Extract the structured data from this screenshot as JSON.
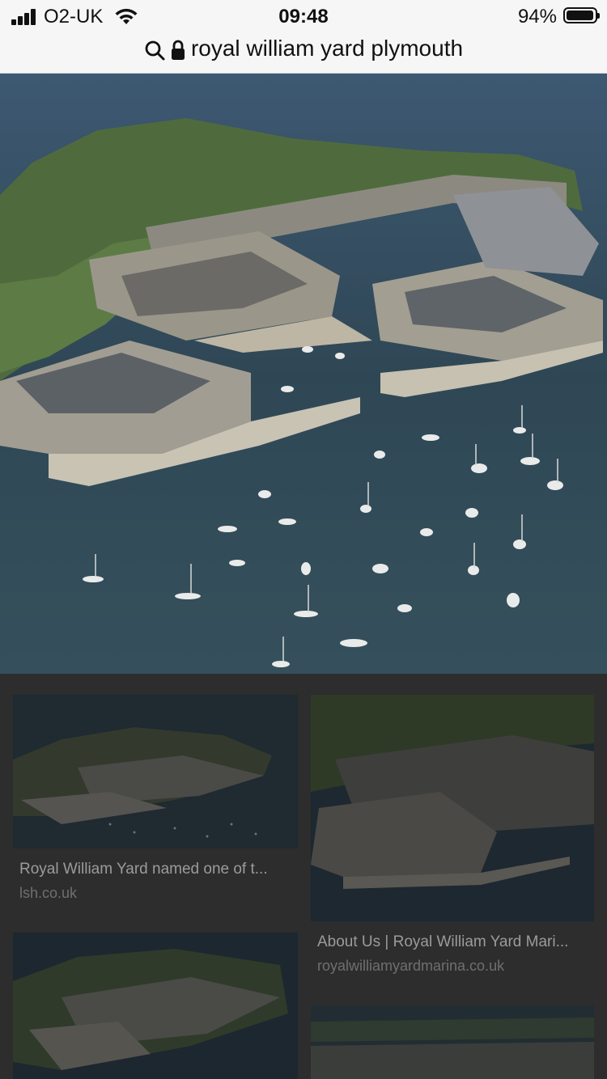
{
  "status_bar": {
    "carrier": "O2-UK",
    "time": "09:48",
    "battery": "94%"
  },
  "address_bar": {
    "query": "royal william yard plymouth"
  },
  "results": [
    {
      "title": "Royal William Yard named one of t...",
      "source": "lsh.co.uk"
    },
    {
      "title": "About Us | Royal William Yard Mari...",
      "source": "royalwilliamyardmarina.co.uk"
    }
  ]
}
